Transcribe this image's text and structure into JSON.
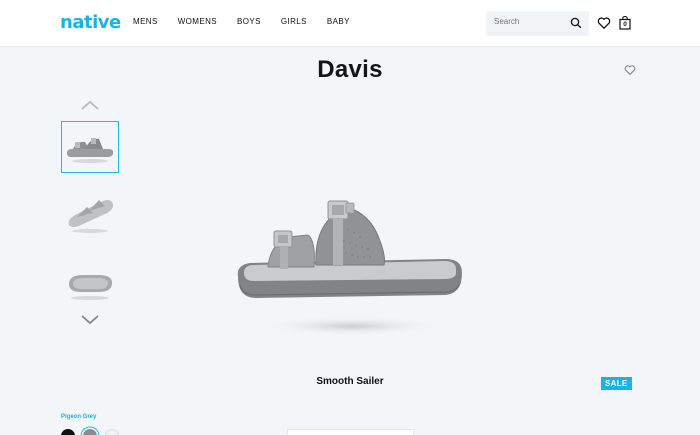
{
  "header": {
    "logo": "native",
    "nav": [
      "MENS",
      "WOMENS",
      "BOYS",
      "GIRLS",
      "BABY"
    ],
    "search_placeholder": "Search",
    "cart_count": "0"
  },
  "product": {
    "name": "Davis",
    "variant": "Smooth Sailer",
    "badge": "SALE",
    "color_name": "Pigeon Grey",
    "swatches": [
      "#111111",
      "#8a8d90",
      "#f2f2f2"
    ],
    "accent": "#1ab3e6"
  }
}
